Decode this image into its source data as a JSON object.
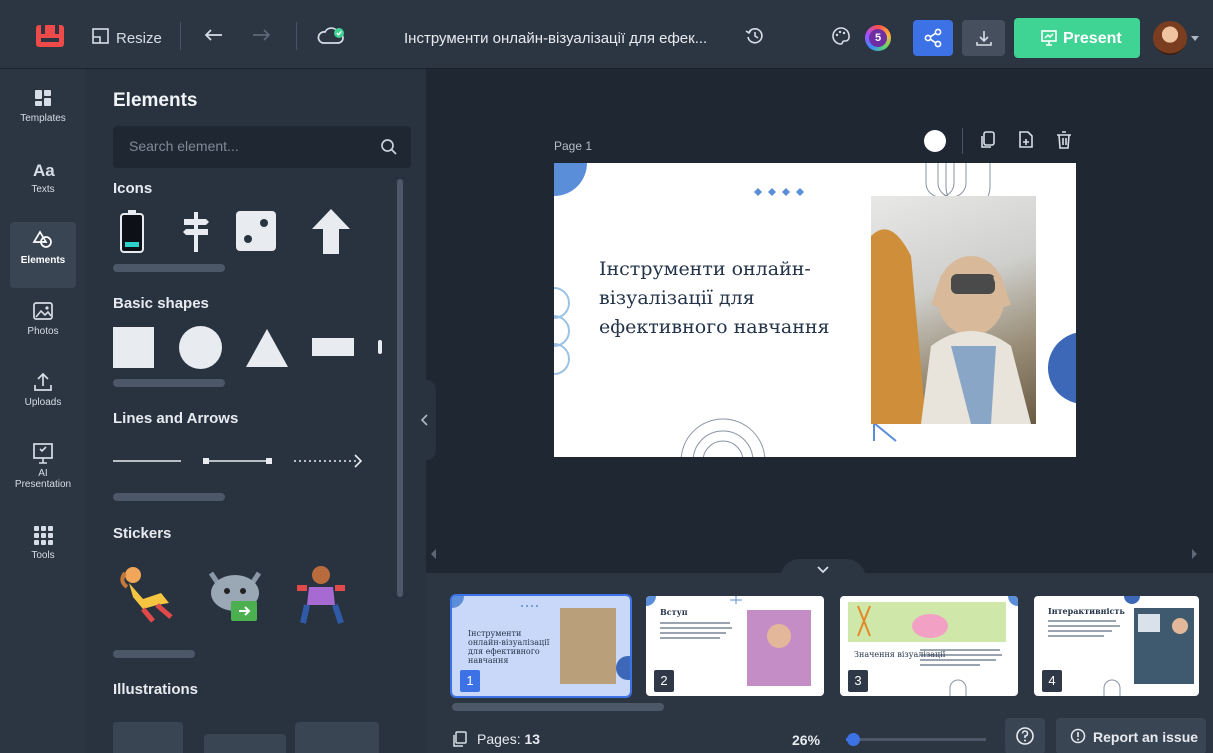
{
  "topbar": {
    "resize_label": "Resize",
    "doc_title": "Інструменти онлайн-візуалізації для ефек...",
    "collaborators_count": "5",
    "present_label": "Present"
  },
  "rail": {
    "items": [
      {
        "label": "Templates",
        "icon": "templates-icon"
      },
      {
        "label": "Texts",
        "icon": "texts-icon"
      },
      {
        "label": "Elements",
        "icon": "elements-icon"
      },
      {
        "label": "Photos",
        "icon": "photos-icon"
      },
      {
        "label": "Uploads",
        "icon": "uploads-icon"
      },
      {
        "label": "AI Presentation",
        "icon": "ai-presentation-icon"
      },
      {
        "label": "Tools",
        "icon": "tools-icon"
      }
    ]
  },
  "panel": {
    "title": "Elements",
    "search_placeholder": "Search element...",
    "sections": {
      "icons": "Icons",
      "shapes": "Basic shapes",
      "lines": "Lines and Arrows",
      "stickers": "Stickers",
      "illustrations": "Illustrations"
    }
  },
  "canvas": {
    "page_label": "Page 1",
    "slide_title": "Інструменти онлайн-візуалізації для ефективного навчання"
  },
  "tray": {
    "thumbs": [
      {
        "num": "1",
        "title": "Інструменти онлайн-візуалізації для ефективного навчання"
      },
      {
        "num": "2",
        "title": "Вступ"
      },
      {
        "num": "3",
        "title": "Значення візуалізації"
      },
      {
        "num": "4",
        "title": "Інтерактивність"
      }
    ],
    "pages_label": "Pages:",
    "pages_count": "13",
    "zoom": "26%",
    "zoom_fraction": 0.05,
    "report_label": "Report an issue"
  },
  "colors": {
    "accent_blue": "#3d72e6",
    "present_green": "#3fd394",
    "logo_red": "#ef4a4a"
  }
}
